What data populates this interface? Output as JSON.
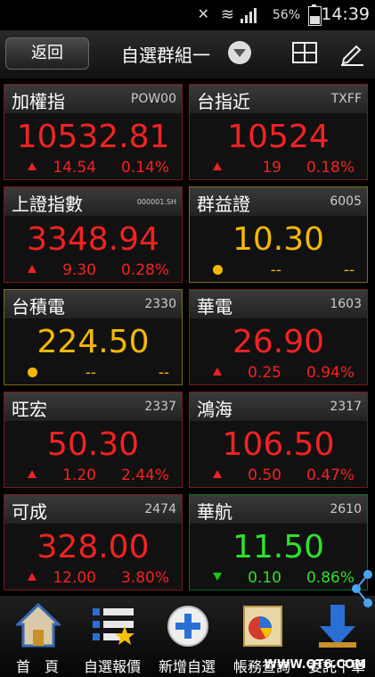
{
  "status": {
    "time": "14:39",
    "battery": "56%"
  },
  "header": {
    "back": "返回",
    "title": "自選群組一"
  },
  "tiles": [
    {
      "name": "加權指",
      "code": "POW00",
      "price": "10532.81",
      "change": "14.54",
      "pct": "0.14%",
      "dir": "up"
    },
    {
      "name": "台指近",
      "code": "TXFF",
      "price": "10524",
      "change": "19",
      "pct": "0.18%",
      "dir": "up"
    },
    {
      "name": "上證指數",
      "code": "000001.SH",
      "price": "3348.94",
      "change": "9.30",
      "pct": "0.28%",
      "dir": "up"
    },
    {
      "name": "群益證",
      "code": "6005",
      "price": "10.30",
      "change": "--",
      "pct": "--",
      "dir": "flat"
    },
    {
      "name": "台積電",
      "code": "2330",
      "price": "224.50",
      "change": "--",
      "pct": "--",
      "dir": "flat"
    },
    {
      "name": "華電",
      "code": "1603",
      "price": "26.90",
      "change": "0.25",
      "pct": "0.94%",
      "dir": "up"
    },
    {
      "name": "旺宏",
      "code": "2337",
      "price": "50.30",
      "change": "1.20",
      "pct": "2.44%",
      "dir": "up"
    },
    {
      "name": "鴻海",
      "code": "2317",
      "price": "106.50",
      "change": "0.50",
      "pct": "0.47%",
      "dir": "up"
    },
    {
      "name": "可成",
      "code": "2474",
      "price": "328.00",
      "change": "12.00",
      "pct": "3.80%",
      "dir": "up"
    },
    {
      "name": "華航",
      "code": "2610",
      "price": "11.50",
      "change": "0.10",
      "pct": "0.86%",
      "dir": "down"
    }
  ],
  "nav": [
    {
      "label": "首　頁",
      "icon": "home-icon"
    },
    {
      "label": "自選報價",
      "icon": "watchlist-icon"
    },
    {
      "label": "新增自選",
      "icon": "add-icon"
    },
    {
      "label": "帳務查詢",
      "icon": "account-icon"
    },
    {
      "label": "委託下單",
      "icon": "order-icon"
    }
  ],
  "footer": {
    "watermark": "WWW.QT6.COM"
  }
}
